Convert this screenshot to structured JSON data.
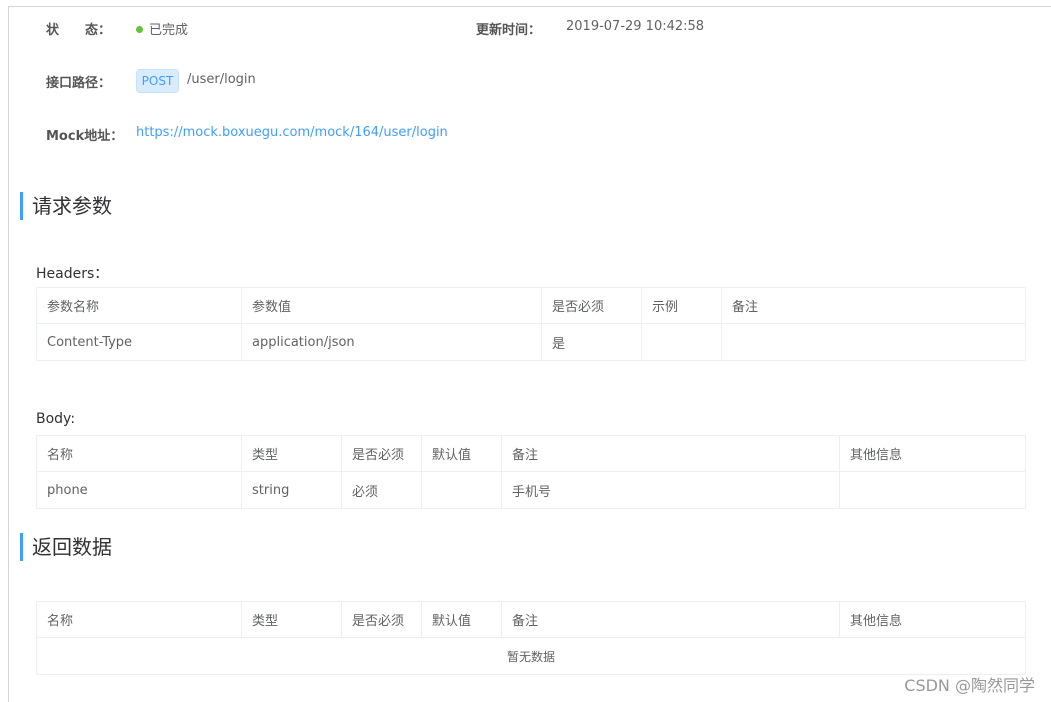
{
  "info": {
    "status_label": "状　　态：",
    "status_value": "已完成",
    "updated_label": "更新时间：",
    "updated_value": "2019-07-29 10:42:58",
    "path_label": "接口路径：",
    "method": "POST",
    "path": "/user/login",
    "mock_label": "Mock地址：",
    "mock_url": "https://mock.boxuegu.com/mock/164/user/login",
    "status_color": "#67c23a"
  },
  "request": {
    "title": "请求参数",
    "headers_title": "Headers：",
    "headers_columns": [
      "参数名称",
      "参数值",
      "是否必须",
      "示例",
      "备注"
    ],
    "headers_rows": [
      [
        "Content-Type",
        "application/json",
        "是",
        "",
        ""
      ]
    ],
    "body_title": "Body:",
    "body_columns": [
      "名称",
      "类型",
      "是否必须",
      "默认值",
      "备注",
      "其他信息"
    ],
    "body_rows": [
      [
        "phone",
        "string",
        "必须",
        "",
        "手机号",
        ""
      ]
    ]
  },
  "response": {
    "title": "返回数据",
    "columns": [
      "名称",
      "类型",
      "是否必须",
      "默认值",
      "备注",
      "其他信息"
    ],
    "empty_text": "暂无数据"
  },
  "watermark": "CSDN @陶然同学",
  "accent_color": "#409eff"
}
